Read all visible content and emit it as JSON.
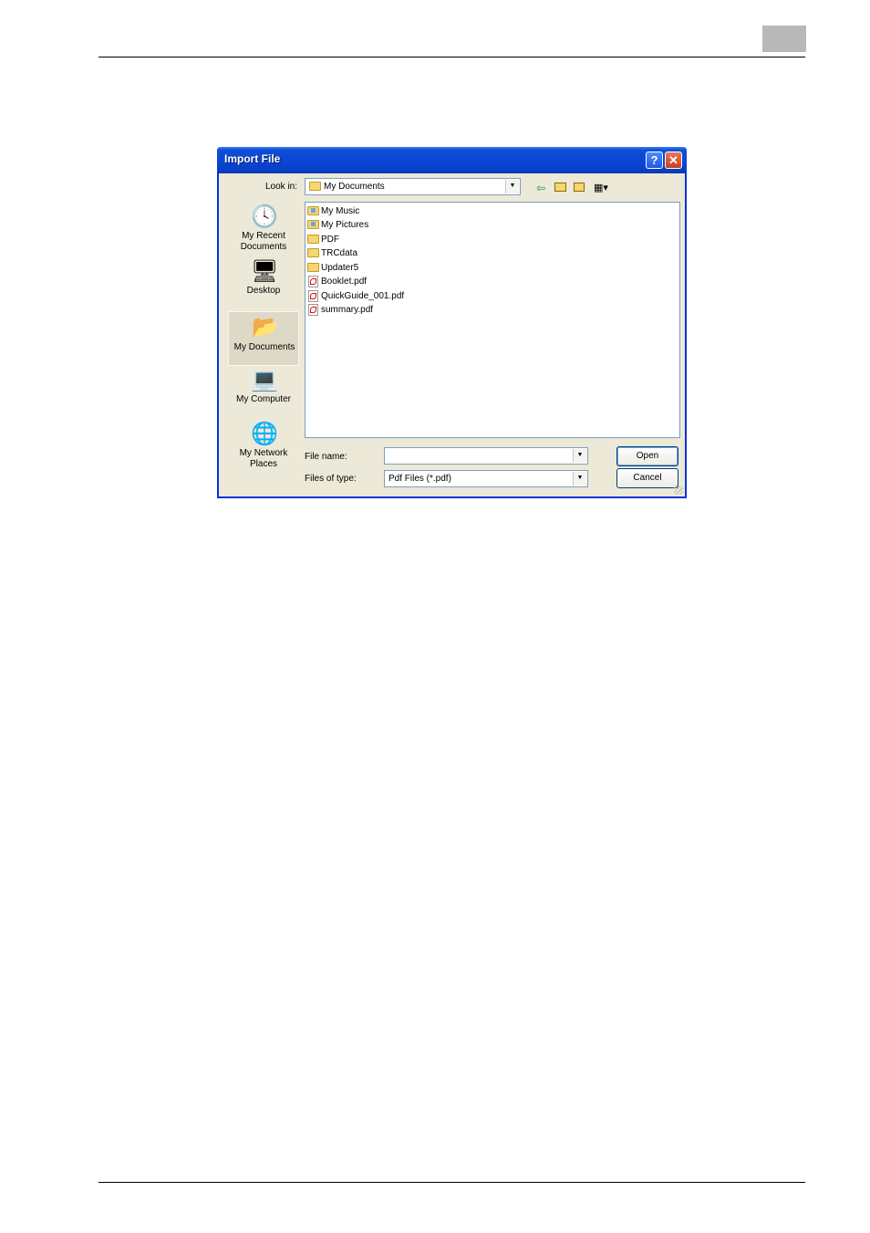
{
  "dialog": {
    "title": "Import File",
    "help_label": "?",
    "close_label": "✕",
    "look_in_label": "Look in:",
    "look_in_value": "My Documents",
    "places": [
      {
        "label": "My Recent\nDocuments",
        "icon": "recent-documents-icon"
      },
      {
        "label": "Desktop",
        "icon": "desktop-icon"
      },
      {
        "label": "My Documents",
        "icon": "my-documents-icon"
      },
      {
        "label": "My Computer",
        "icon": "my-computer-icon"
      },
      {
        "label": "My Network\nPlaces",
        "icon": "network-places-icon"
      }
    ],
    "files": [
      {
        "name": "My Music",
        "type": "folder"
      },
      {
        "name": "My Pictures",
        "type": "folder"
      },
      {
        "name": "PDF",
        "type": "folder"
      },
      {
        "name": "TRCdata",
        "type": "folder"
      },
      {
        "name": "Updater5",
        "type": "folder"
      },
      {
        "name": "Booklet.pdf",
        "type": "pdf"
      },
      {
        "name": "QuickGuide_001.pdf",
        "type": "pdf"
      },
      {
        "name": "summary.pdf",
        "type": "pdf"
      }
    ],
    "file_name_label": "File name:",
    "file_name_value": "",
    "files_of_type_label": "Files of type:",
    "files_of_type_value": "Pdf Files (*.pdf)",
    "open_label": "Open",
    "cancel_label": "Cancel"
  }
}
